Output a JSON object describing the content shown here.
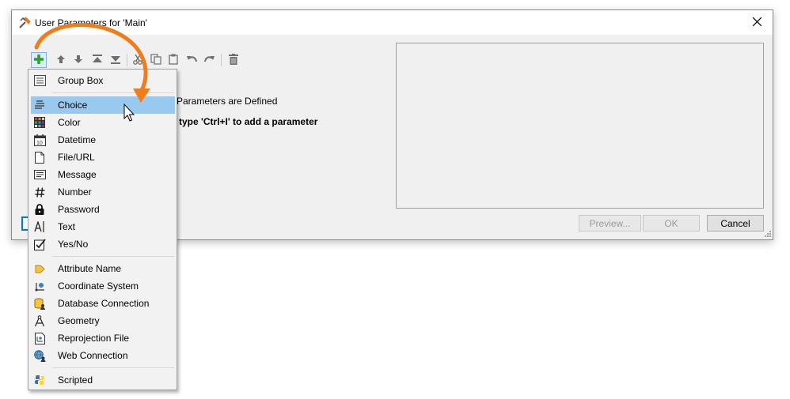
{
  "dialog": {
    "title": "User Parameters for 'Main'",
    "empty_message": "Parameters are Defined",
    "hint_message": "r type 'Ctrl+I' to add a parameter"
  },
  "toolbar": {
    "icons": [
      "add-icon",
      "move-up-icon",
      "move-down-icon",
      "move-top-icon",
      "move-bottom-icon",
      "cut-icon",
      "copy-icon",
      "paste-icon",
      "undo-icon",
      "redo-icon",
      "delete-icon"
    ]
  },
  "buttons": {
    "preview": "Preview...",
    "ok": "OK",
    "cancel": "Cancel"
  },
  "menu": {
    "group1": [
      {
        "label": "Group Box",
        "icon": "group-box-icon"
      }
    ],
    "group2": [
      {
        "label": "Choice",
        "icon": "choice-icon",
        "highlighted": true
      },
      {
        "label": "Color",
        "icon": "color-icon"
      },
      {
        "label": "Datetime",
        "icon": "calendar-icon"
      },
      {
        "label": "File/URL",
        "icon": "file-icon"
      },
      {
        "label": "Message",
        "icon": "message-icon"
      },
      {
        "label": "Number",
        "icon": "hash-icon"
      },
      {
        "label": "Password",
        "icon": "lock-icon"
      },
      {
        "label": "Text",
        "icon": "text-cursor-icon"
      },
      {
        "label": "Yes/No",
        "icon": "checkbox-icon"
      }
    ],
    "group3": [
      {
        "label": "Attribute Name",
        "icon": "attribute-icon"
      },
      {
        "label": "Coordinate System",
        "icon": "coordinate-system-icon"
      },
      {
        "label": "Database Connection",
        "icon": "database-icon"
      },
      {
        "label": "Geometry",
        "icon": "geometry-icon"
      },
      {
        "label": "Reprojection File",
        "icon": "reprojection-file-icon"
      },
      {
        "label": "Web Connection",
        "icon": "web-connection-icon"
      }
    ],
    "group4": [
      {
        "label": "Scripted",
        "icon": "python-icon"
      }
    ]
  },
  "colors": {
    "accent": "#0078d7",
    "highlight": "#99c9ef",
    "arrow": "#f07d1c",
    "add_green": "#2ca02c"
  }
}
